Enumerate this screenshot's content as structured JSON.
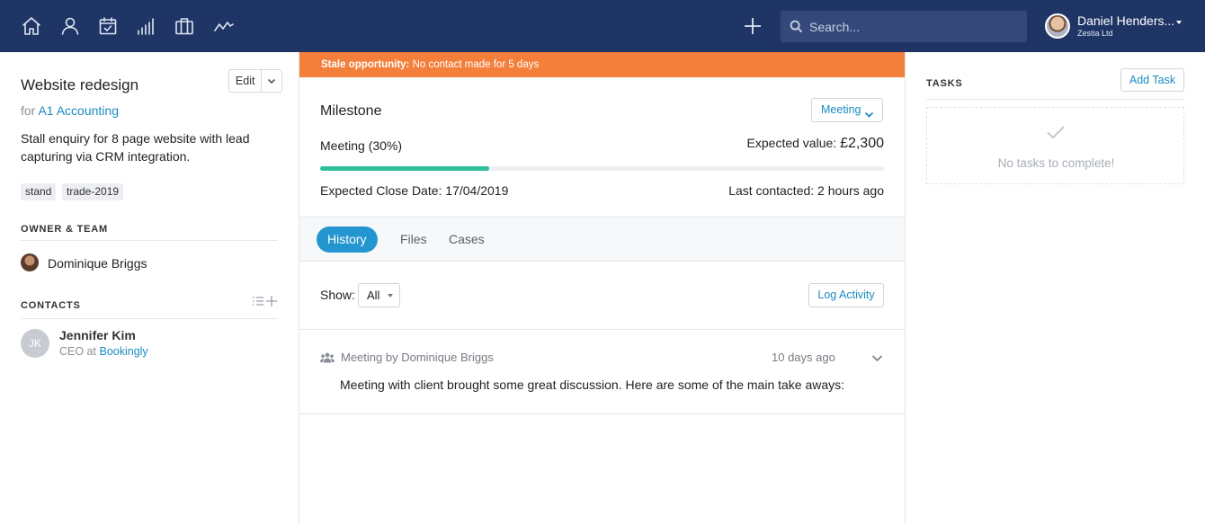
{
  "topbar": {
    "nav_icons": [
      "home-icon",
      "person-icon",
      "calendar-check-icon",
      "bar-chart-icon",
      "briefcase-icon",
      "activity-icon"
    ],
    "add_icon": "plus-icon",
    "search": {
      "placeholder": "Search..."
    },
    "user": {
      "name": "Daniel Henders...",
      "org": "Zestia Ltd"
    },
    "colors": {
      "bar": "#1f3566",
      "search_bg": "#34497a"
    }
  },
  "deal": {
    "title": "Website redesign",
    "edit_label": "Edit",
    "for_prefix": "for",
    "for_company": "A1 Accounting",
    "description": "Stall enquiry for 8 page website with lead capturing via CRM integration.",
    "tags": [
      "stand",
      "trade-2019"
    ]
  },
  "owner_team": {
    "heading": "OWNER & TEAM",
    "owner_name": "Dominique Briggs"
  },
  "contacts": {
    "heading": "CONTACTS",
    "items": [
      {
        "initials": "JK",
        "name": "Jennifer Kim",
        "role_prefix": "CEO at",
        "company": "Bookingly"
      }
    ]
  },
  "banner": {
    "label": "Stale opportunity:",
    "text": "No contact made for 5 days",
    "color": "#f47f3b"
  },
  "milestone": {
    "heading": "Milestone",
    "stage_dropdown": "Meeting",
    "stage_text": "Meeting (30%)",
    "progress_fraction": 0.3,
    "expected_value_label": "Expected value:",
    "expected_value": "£2,300",
    "close_date": "Expected Close Date: 17/04/2019",
    "last_contacted": "Last contacted: 2 hours ago",
    "accent": "#2fbf9a"
  },
  "tabs": [
    {
      "label": "History",
      "active": true
    },
    {
      "label": "Files",
      "active": false
    },
    {
      "label": "Cases",
      "active": false
    }
  ],
  "history": {
    "show_label": "Show:",
    "show_value": "All",
    "log_button": "Log Activity",
    "activity": {
      "icon": "group-icon",
      "title": "Meeting by Dominique Briggs",
      "time": "10 days ago",
      "body": "Meeting with client brought some great discussion. Here are some of the main take aways:"
    }
  },
  "tasks": {
    "heading": "TASKS",
    "add_button": "Add Task",
    "empty_text": "No tasks to complete!"
  }
}
